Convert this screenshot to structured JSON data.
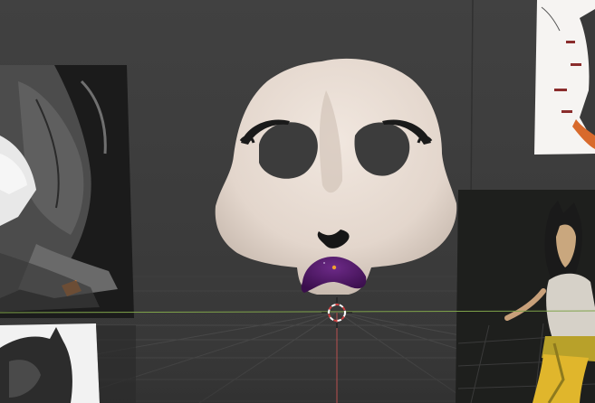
{
  "viewport": {
    "editor": "3D Viewport",
    "background_color": "#3d3d3d",
    "grid_color": "#4a4a4a",
    "x_axis_color": "#7fa34a",
    "z_axis_color": "#b8504f"
  },
  "scene_objects": [
    {
      "name": "skull-mask",
      "color": "#e8dcd3"
    },
    {
      "name": "reference-image-left-top",
      "style": "monochrome-drawing"
    },
    {
      "name": "reference-image-left-bottom",
      "style": "monochrome-drawing"
    },
    {
      "name": "reference-image-right-top",
      "style": "sketch"
    },
    {
      "name": "reference-image-right-bottom",
      "style": "render-figure"
    }
  ],
  "gizmos": {
    "cursor": "3d-cursor-icon"
  }
}
